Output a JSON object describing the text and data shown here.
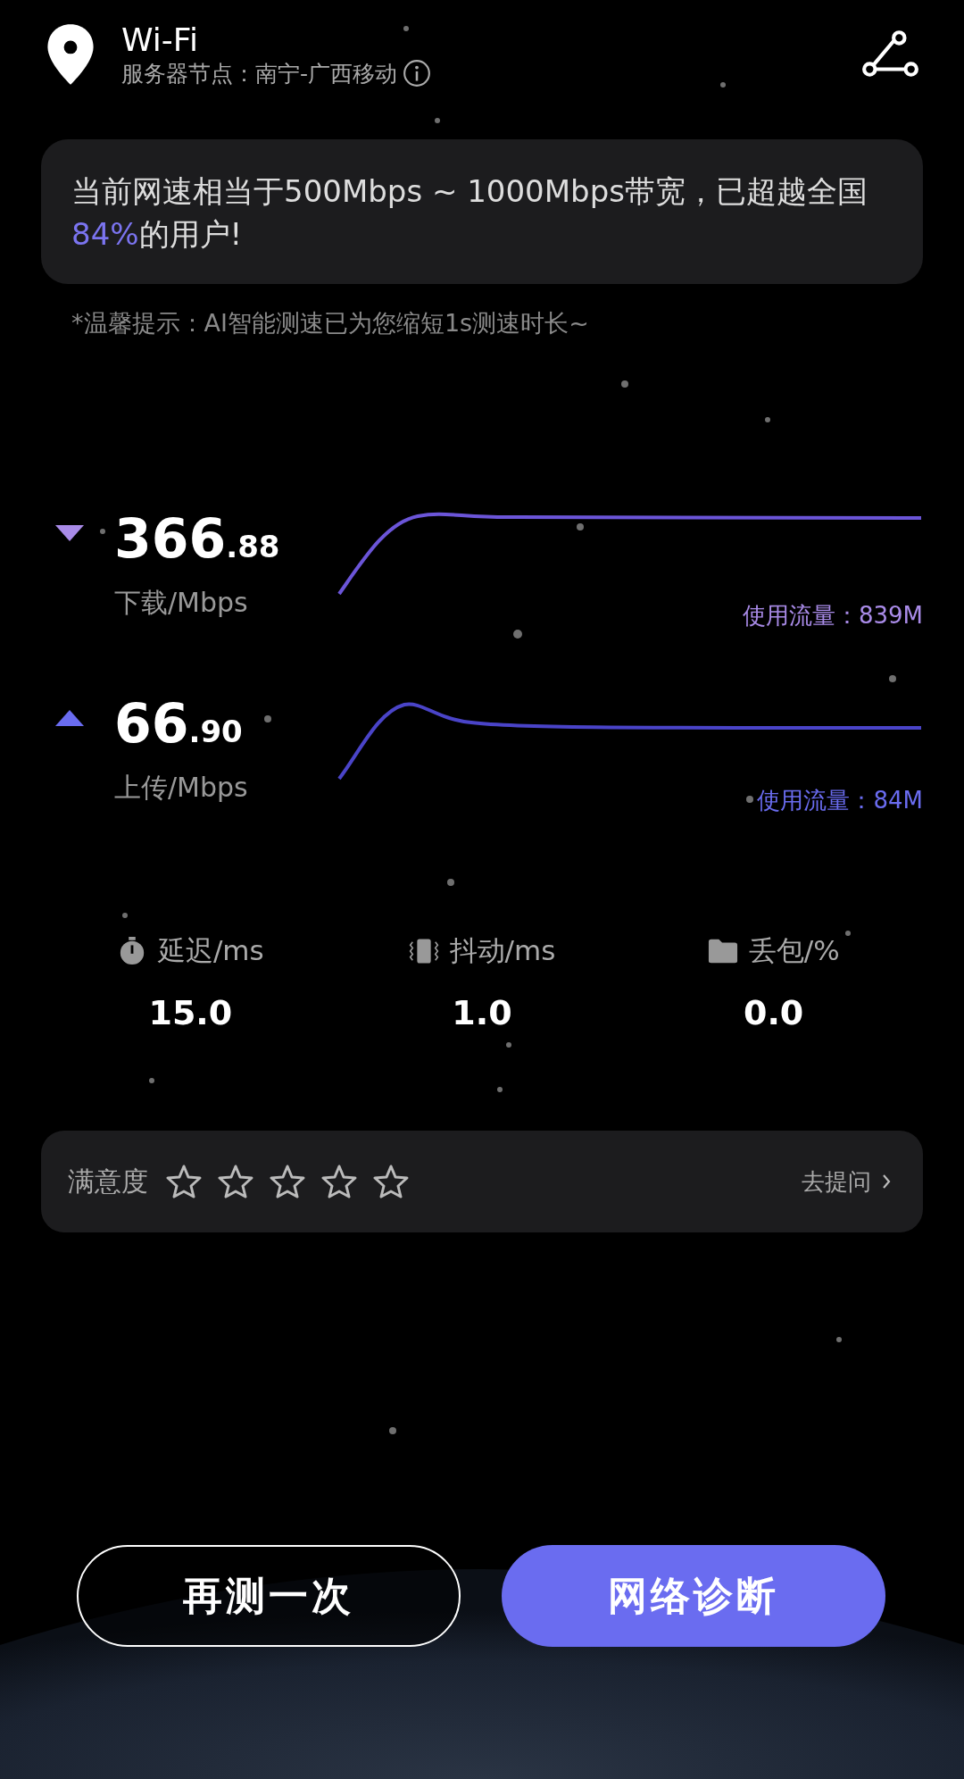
{
  "header": {
    "title": "Wi-Fi",
    "server_label": "服务器节点：南宁-广西移动"
  },
  "result_card": {
    "text_before": "当前网速相当于500Mbps ~ 1000Mbps带宽，已超越全国",
    "highlight": "84%",
    "text_after": "的用户!"
  },
  "tip": "*温馨提示：AI智能测速已为您缩短1s测速时长~",
  "speeds": [
    {
      "kind": "download",
      "value": "366",
      "decimal": ".88",
      "unit": "下载/Mbps",
      "usage": "使用流量：839M",
      "color": "#a98be8"
    },
    {
      "kind": "upload",
      "value": "66",
      "decimal": ".90",
      "unit": "上传/Mbps",
      "usage": "使用流量：84M",
      "color": "#6a6cf0"
    }
  ],
  "metrics": [
    {
      "kind": "latency",
      "label": "延迟/ms",
      "value": "15.0"
    },
    {
      "kind": "jitter",
      "label": "抖动/ms",
      "value": "1.0"
    },
    {
      "kind": "loss",
      "label": "丢包/%",
      "value": "0.0"
    }
  ],
  "satisfaction": {
    "label": "满意度",
    "stars": 0,
    "link": "去提问"
  },
  "buttons": [
    {
      "kind": "outline",
      "label": "再测一次"
    },
    {
      "kind": "primary",
      "label": "网络诊断"
    }
  ]
}
